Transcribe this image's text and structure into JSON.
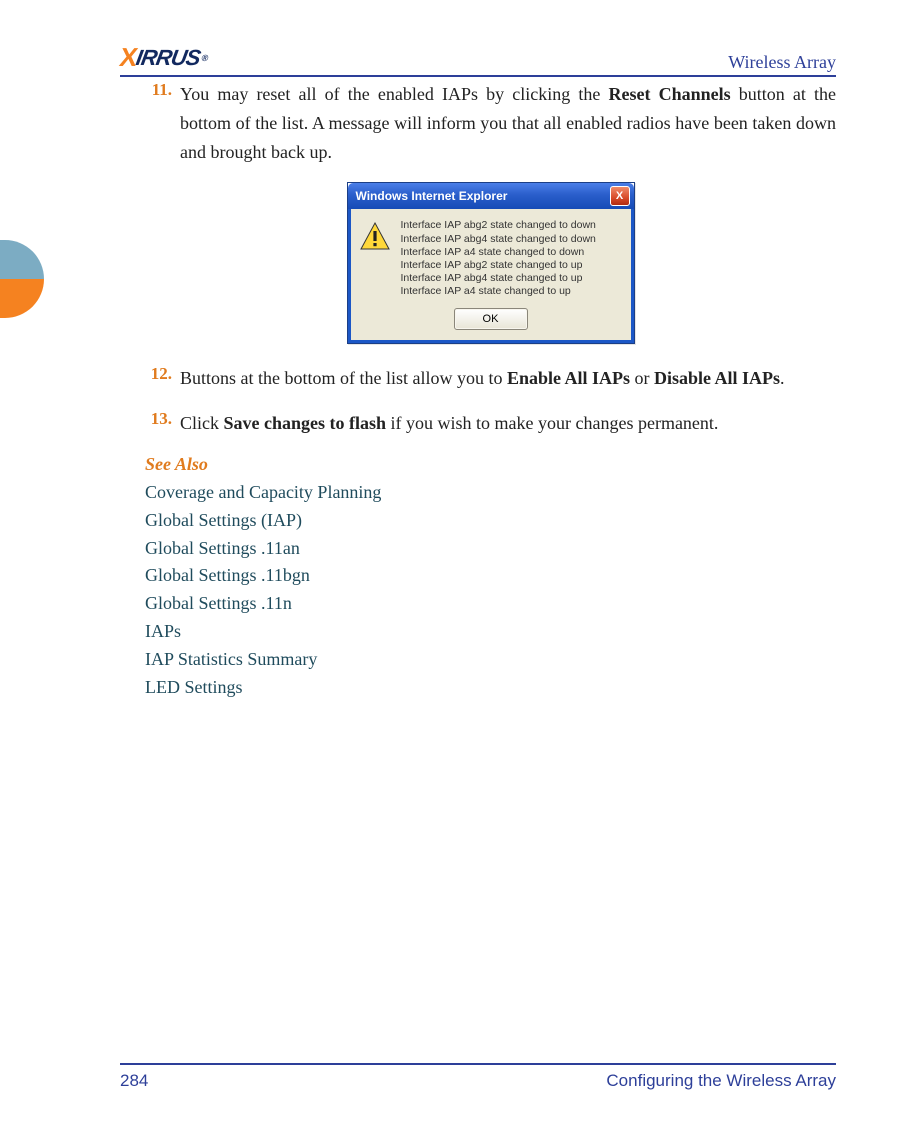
{
  "header": {
    "logo_text": "XIRRUS",
    "title": "Wireless Array"
  },
  "steps": [
    {
      "num": "11.",
      "segments": [
        {
          "t": "You may reset all of the enabled IAPs by clicking the "
        },
        {
          "t": "Reset Channels",
          "b": true
        },
        {
          "t": " button at the bottom of the list. A message will inform you that all enabled radios have been taken down and brought back up."
        }
      ]
    },
    {
      "num": "12.",
      "segments": [
        {
          "t": "Buttons at the bottom of the list allow you to "
        },
        {
          "t": "Enable All IAPs",
          "b": true
        },
        {
          "t": " or "
        },
        {
          "t": "Disable All IAPs",
          "b": true
        },
        {
          "t": "."
        }
      ]
    },
    {
      "num": "13.",
      "segments": [
        {
          "t": "Click "
        },
        {
          "t": "Save changes to flash",
          "b": true
        },
        {
          "t": " if you wish to make your changes permanent."
        }
      ]
    }
  ],
  "dialog": {
    "title": "Windows Internet Explorer",
    "messages": [
      "Interface IAP abg2 state changed to down",
      "Interface IAP abg4 state changed to down",
      "Interface IAP a4 state changed to down",
      "Interface IAP abg2 state changed to up",
      "Interface IAP abg4 state changed to up",
      "Interface IAP a4 state changed to up"
    ],
    "ok_label": "OK",
    "close_label": "X"
  },
  "see_also": {
    "heading": "See Also",
    "links": [
      "Coverage and Capacity Planning",
      "Global Settings (IAP)",
      "Global Settings .11an",
      "Global Settings .11bgn",
      "Global Settings .11n",
      "IAPs",
      "IAP Statistics Summary",
      "LED Settings"
    ]
  },
  "footer": {
    "page_number": "284",
    "section_title": "Configuring the Wireless Array"
  }
}
